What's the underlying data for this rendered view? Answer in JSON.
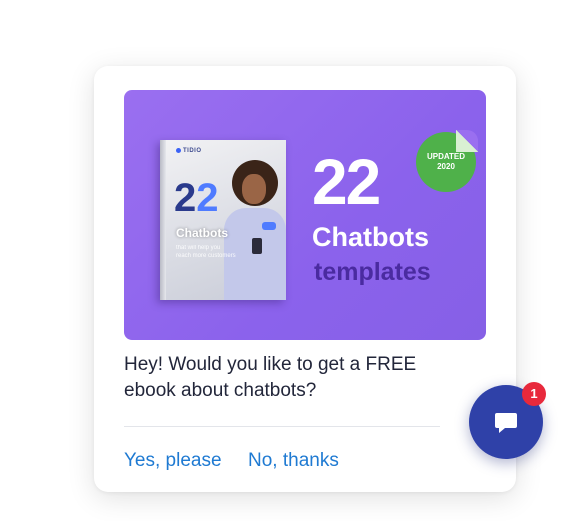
{
  "banner": {
    "ebook": {
      "brand": "TIDIO",
      "number_main": "2",
      "number_accent": "2",
      "title": "Chatbots",
      "subtitle": "that will help you reach more customers"
    },
    "headline_number": "22",
    "headline_title": "Chatbots",
    "headline_subtitle": "templates",
    "sticker_line1": "UPDATED",
    "sticker_line2": "2020"
  },
  "popup": {
    "message": "Hey! Would you like to get a FREE ebook about chatbots?",
    "accept_label": "Yes, please",
    "decline_label": "No, thanks"
  },
  "chat_launcher": {
    "unread_count": "1"
  },
  "colors": {
    "banner_purple": "#9a6ff0",
    "link_blue": "#1f7ad2",
    "launcher_blue": "#2f41a8",
    "badge_red": "#e8293c",
    "sticker_green": "#4fb14a"
  }
}
